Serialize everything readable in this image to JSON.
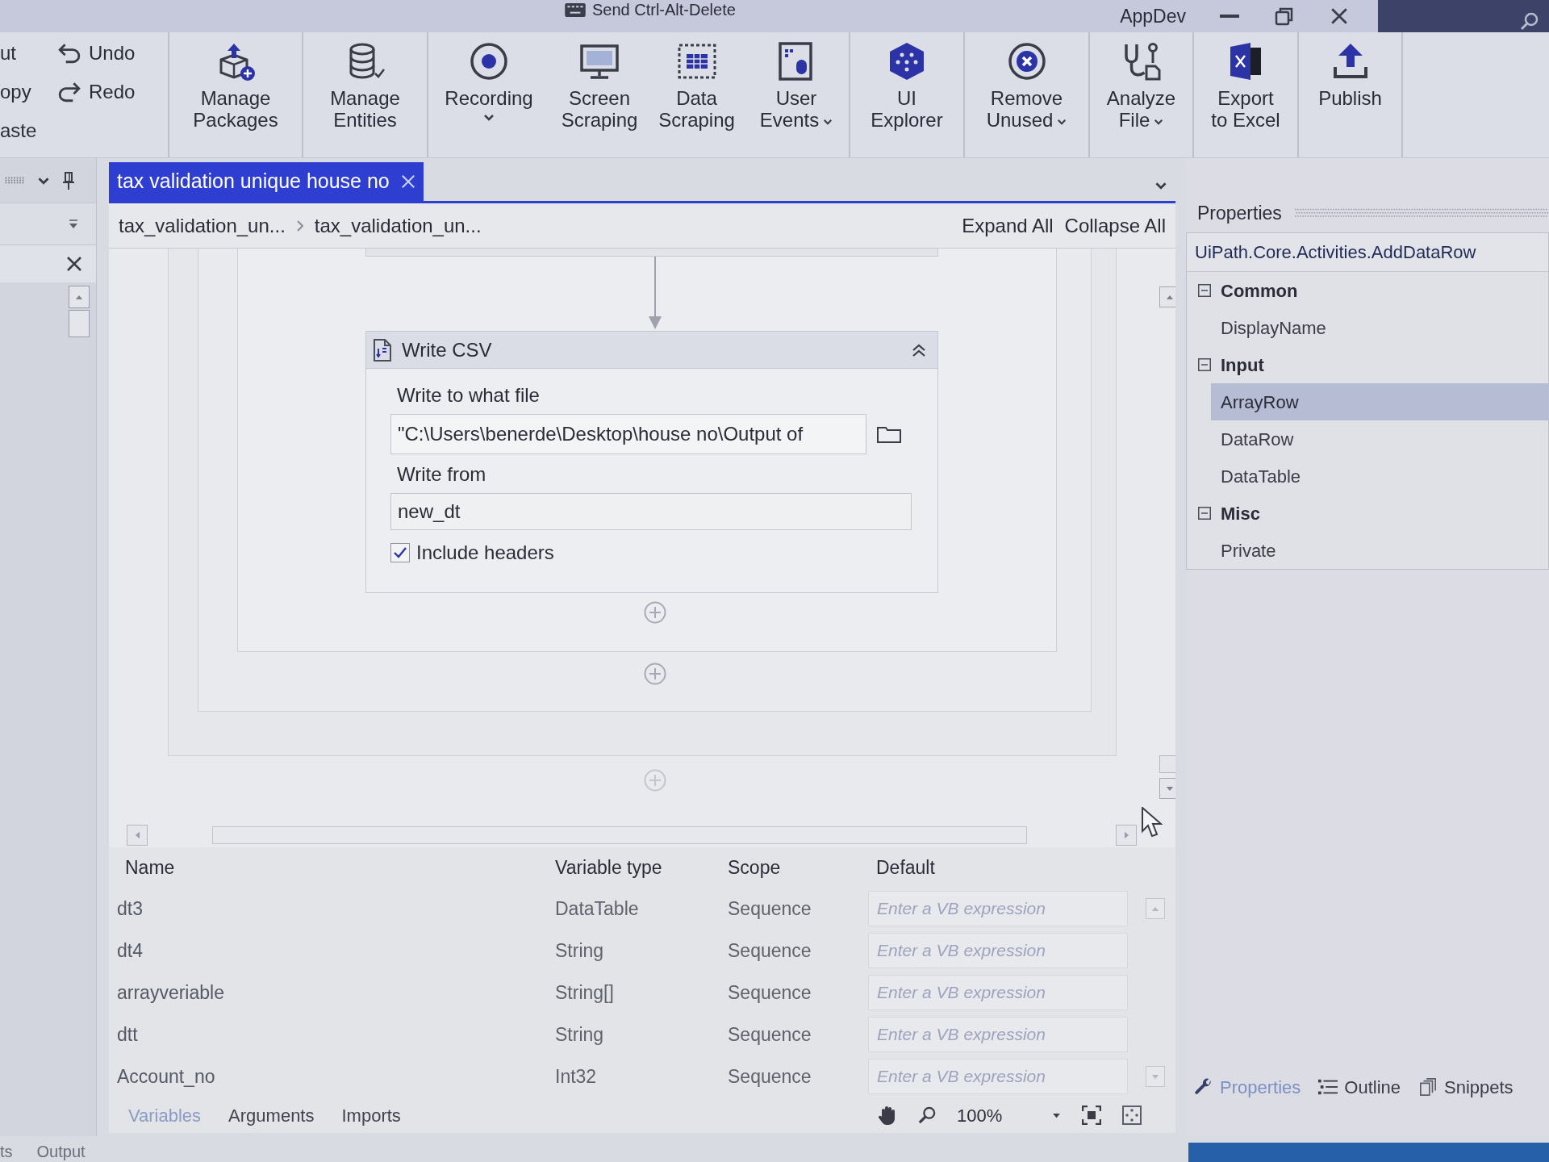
{
  "title_bar": {
    "command": "Send Ctrl-Alt-Delete",
    "title": "AppDev"
  },
  "ribbon": {
    "clipboard": [
      "ut",
      "opy",
      "aste"
    ],
    "history": [
      {
        "label": "Undo"
      },
      {
        "label": "Redo"
      }
    ],
    "groups": [
      {
        "buttons": [
          {
            "label": "Manage\nPackages",
            "dropdown": false
          }
        ]
      },
      {
        "buttons": [
          {
            "label": "Manage\nEntities",
            "dropdown": false
          }
        ]
      },
      {
        "buttons": [
          {
            "label": "Recording",
            "dropdown": true
          },
          {
            "label": "Screen\nScraping",
            "dropdown": false
          },
          {
            "label": "Data\nScraping",
            "dropdown": false
          },
          {
            "label": "User\nEvents",
            "dropdown": true
          }
        ]
      },
      {
        "buttons": [
          {
            "label": "UI\nExplorer",
            "dropdown": false
          }
        ]
      },
      {
        "buttons": [
          {
            "label": "Remove\nUnused",
            "dropdown": true
          }
        ]
      },
      {
        "buttons": [
          {
            "label": "Analyze\nFile",
            "dropdown": true
          }
        ]
      },
      {
        "buttons": [
          {
            "label": "Export\nto Excel",
            "dropdown": false
          }
        ]
      },
      {
        "buttons": [
          {
            "label": "Publish",
            "dropdown": false
          }
        ]
      }
    ]
  },
  "document_tabs": [
    {
      "label": "tax validation unique house no",
      "selected": true
    }
  ],
  "breadcrumb": [
    "tax_validation_un...",
    "tax_validation_un..."
  ],
  "designer_actions": [
    "Expand All",
    "Collapse All"
  ],
  "activity": {
    "title": "Write CSV",
    "fields": [
      {
        "label": "Write to what file",
        "value": "\"C:\\Users\\benerde\\Desktop\\house no\\Output of",
        "browse": true
      },
      {
        "label": "Write from",
        "value": "new_dt",
        "browse": false
      }
    ],
    "options": [
      {
        "label": "Include headers",
        "checked": true
      }
    ]
  },
  "variables": {
    "columns": [
      "Name",
      "Variable type",
      "Scope",
      "Default"
    ],
    "rows": [
      {
        "name": "dt3",
        "type": "DataTable",
        "scope": "Sequence",
        "placeholder": "Enter a VB expression"
      },
      {
        "name": "dt4",
        "type": "String",
        "scope": "Sequence",
        "placeholder": "Enter a VB expression"
      },
      {
        "name": "arrayveriable",
        "type": "String[]",
        "scope": "Sequence",
        "placeholder": "Enter a VB expression"
      },
      {
        "name": "dtt",
        "type": "String",
        "scope": "Sequence",
        "placeholder": "Enter a VB expression"
      },
      {
        "name": "Account_no",
        "type": "Int32",
        "scope": "Sequence",
        "placeholder": "Enter a VB expression"
      }
    ]
  },
  "variables_tabs": [
    {
      "label": "Variables",
      "selected": true
    },
    {
      "label": "Arguments",
      "selected": false
    },
    {
      "label": "Imports",
      "selected": false
    }
  ],
  "zoom": "100%",
  "properties": {
    "title": "Properties",
    "type_name": "UiPath.Core.Activities.AddDataRow",
    "categories": [
      {
        "name": "Common",
        "expanded": true,
        "items": [
          {
            "name": "DisplayName",
            "selected": false
          }
        ]
      },
      {
        "name": "Input",
        "expanded": true,
        "items": [
          {
            "name": "ArrayRow",
            "selected": true
          },
          {
            "name": "DataRow",
            "selected": false
          },
          {
            "name": "DataTable",
            "selected": false
          }
        ]
      },
      {
        "name": "Misc",
        "expanded": true,
        "items": [
          {
            "name": "Private",
            "selected": false
          }
        ]
      }
    ]
  },
  "panel_tabs": [
    {
      "label": "Properties",
      "selected": true
    },
    {
      "label": "Outline",
      "selected": false
    },
    {
      "label": "Snippets",
      "selected": false
    }
  ],
  "output_tabs": [
    "ts",
    "Output"
  ]
}
